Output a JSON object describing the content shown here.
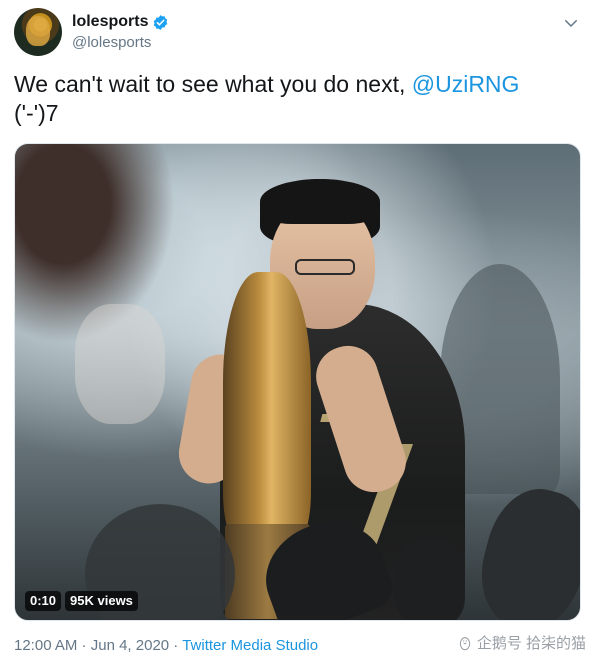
{
  "account": {
    "display_name": "lolesports",
    "handle": "@lolesports",
    "verified": true
  },
  "tweet": {
    "text_before": "We can't wait to see what you do next, ",
    "mention": "@UziRNG",
    "text_after": "\n('-')7"
  },
  "media": {
    "duration": "0:10",
    "views": "95K views"
  },
  "meta": {
    "time": "12:00 AM",
    "separator_1": " · ",
    "date": "Jun 4, 2020",
    "separator_2": " · ",
    "source": "Twitter Media Studio"
  },
  "watermark": {
    "text": "企鹅号 拾柒的猫"
  },
  "colors": {
    "link": "#1b95e0",
    "secondary_text": "#657786",
    "primary_text": "#14171a",
    "verified_badge": "#1da1f2"
  },
  "icons": {
    "verified": "verified-badge-icon",
    "menu": "chevron-down-icon",
    "watermark": "penguin-logo-icon"
  }
}
